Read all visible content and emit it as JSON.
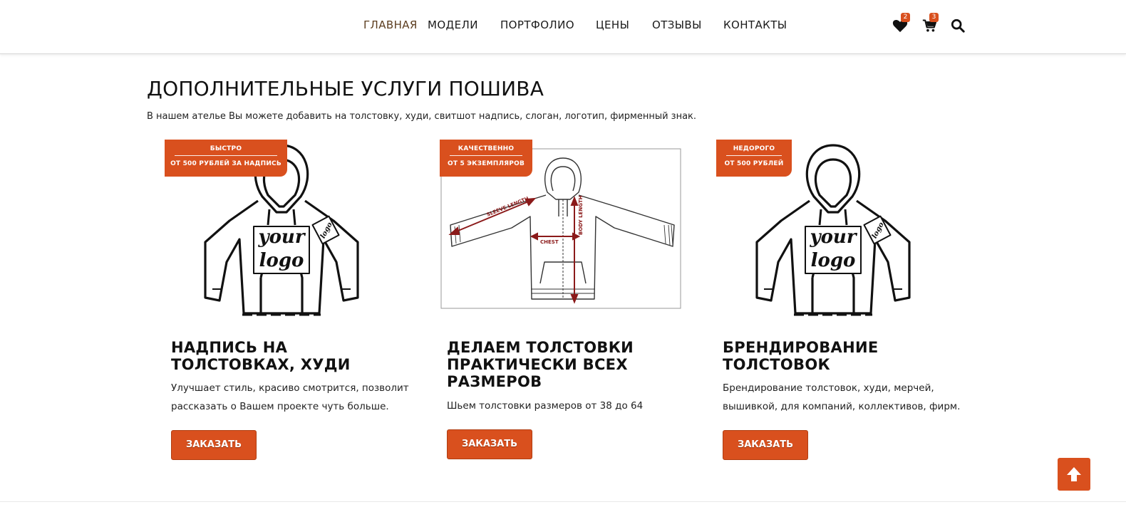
{
  "nav": {
    "items": [
      {
        "label": "ГЛАВНАЯ",
        "active": true
      },
      {
        "label": "МОДЕЛИ",
        "active": false
      },
      {
        "label": "ПОРТФОЛИО",
        "active": false
      },
      {
        "label": "ЦЕНЫ",
        "active": false
      },
      {
        "label": "ОТЗЫВЫ",
        "active": false
      },
      {
        "label": "КОНТАКТЫ",
        "active": false
      }
    ]
  },
  "header_icons": {
    "wishlist": {
      "icon": "heart-icon",
      "count": "2"
    },
    "cart": {
      "icon": "cart-icon",
      "count": "3"
    },
    "search": {
      "icon": "search-icon"
    }
  },
  "section": {
    "title": "ДОПОЛНИТЕЛЬНЫЕ УСЛУГИ ПОШИВА",
    "subtitle": "В нашем ателье Вы можете добавить на толстовку, худи, свитшот надпись, слоган, логотип, фирменный знак."
  },
  "cards": [
    {
      "ribbon_top": "БЫСТРО",
      "ribbon_bottom": "ОТ 500 РУБЛЕЙ ЗА НАДПИСЬ",
      "image_text_top": "your",
      "image_text_bottom": "logo",
      "image_sleeve_text": "logo",
      "title": "НАДПИСЬ НА ТОЛСТОВКАХ, ХУДИ",
      "description": "Улучшает стиль, красиво смотрится, позволит рассказать о Вашем проекте чуть больше.",
      "button": "ЗАКАЗАТЬ"
    },
    {
      "ribbon_top": "КАЧЕСТВЕННО",
      "ribbon_bottom": "ОТ 5 ЭКЗЕМПЛЯРОВ",
      "diagram_labels": {
        "sleeve": "SLEEVE LENGTH",
        "body": "BODY LENGTH",
        "chest": "CHEST"
      },
      "title": "ДЕЛАЕМ ТОЛСТОВКИ ПРАКТИЧЕСКИ ВСЕХ РАЗМЕРОВ",
      "description": "Шьем толстовки размеров от 38 до 64",
      "button": "ЗАКАЗАТЬ"
    },
    {
      "ribbon_top": "НЕДОРОГО",
      "ribbon_bottom": "ОТ 500 РУБЛЕЙ",
      "image_text_top": "your",
      "image_text_bottom": "logo",
      "image_sleeve_text": "logo",
      "title": "БРЕНДИРОВАНИЕ ТОЛСТОВОК",
      "description": "Брендирование толстовок, худи, мерчей, вышивкой, для компаний, коллективов, фирм.",
      "button": "ЗАКАЗАТЬ"
    }
  ],
  "scroll_top": {
    "icon": "arrow-up-icon"
  },
  "colors": {
    "accent": "#d9501e",
    "active_nav": "#5c3d1f",
    "diagram_red": "#8b1a1a"
  }
}
